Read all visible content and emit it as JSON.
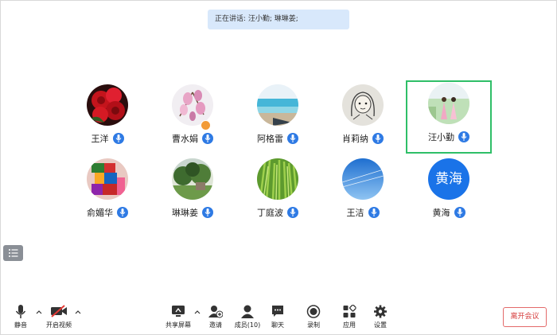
{
  "speaking_banner": "正在讲话: 汪小勤; 琳琳姜;",
  "participants": [
    {
      "name": "王洋",
      "avatar": "roses-photo"
    },
    {
      "name": "曹水娟",
      "avatar": "magnolia-photo",
      "host_badge": true
    },
    {
      "name": "阿格雷",
      "avatar": "beach-photo"
    },
    {
      "name": "肖莉纳",
      "avatar": "sketch-girl-drawing"
    },
    {
      "name": "汪小勤",
      "avatar": "couple-garden-photo",
      "active_speaker": true
    },
    {
      "name": "俞媚华",
      "avatar": "lego-photo"
    },
    {
      "name": "琳琳姜",
      "avatar": "garden-photo"
    },
    {
      "name": "丁庭波",
      "avatar": "rice-field-photo"
    },
    {
      "name": "王洁",
      "avatar": "blue-sky-photo"
    },
    {
      "name": "黄海",
      "avatar": "text-avatar",
      "avatar_text": "黄海"
    }
  ],
  "toolbar": {
    "mute": "静音",
    "video": "开启视频",
    "share": "共享屏幕",
    "invite": "邀请",
    "members": "成员(10)",
    "chat": "聊天",
    "record": "录制",
    "apps": "应用",
    "settings": "设置",
    "leave": "离开会议"
  },
  "colors": {
    "accent": "#2e7ae4",
    "active_border": "#2fbf68",
    "leave": "#d63c3c",
    "banner_bg": "#d8e8fb"
  }
}
